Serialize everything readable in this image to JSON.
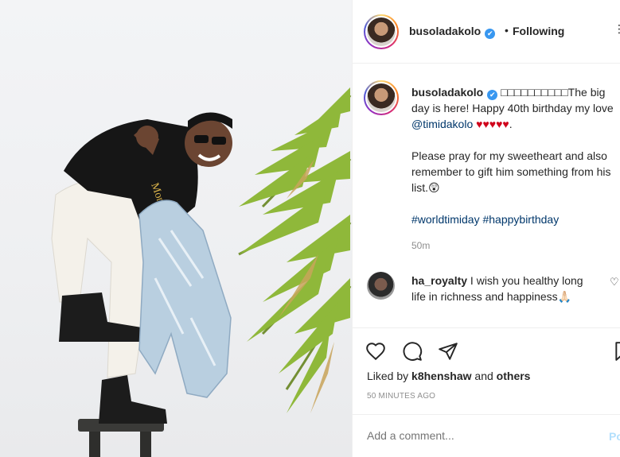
{
  "post": {
    "author": "busoladakolo",
    "verified_mark": "✔",
    "dot": "•",
    "follow_state": "Following",
    "more_icon": "⋮"
  },
  "caption": {
    "username": "busoladakolo",
    "line_prefix": "□□□□□□□□□□The big day is here! Happy 40th birthday my love ",
    "mention": "@timidakolo",
    "hearts": "♥♥♥♥♥",
    "line_suffix": ".",
    "paragraph2": "Please pray for my sweetheart and also remember to gift him something from his list.😲",
    "hashtags": "#worldtimiday #happybirthday",
    "time": "50m"
  },
  "comment": {
    "username": "ha_royalty",
    "text": " I wish you healthy long life in richness and happiness🙏🏻",
    "like_icon": "♡"
  },
  "actions": {
    "liked_prefix": "Liked by ",
    "liked_user": "k8henshaw",
    "liked_and": " and ",
    "liked_others": "others",
    "posted_time": "50 MINUTES AGO"
  },
  "add_comment": {
    "placeholder": "Add a comment...",
    "post_label": "Po"
  },
  "colors": {
    "link": "#00376b",
    "verified": "#3897f0",
    "heart": "#d0021b",
    "muted": "#8e8e8e"
  },
  "icons": [
    "heart-icon",
    "comment-icon",
    "share-icon",
    "bookmark-icon"
  ]
}
